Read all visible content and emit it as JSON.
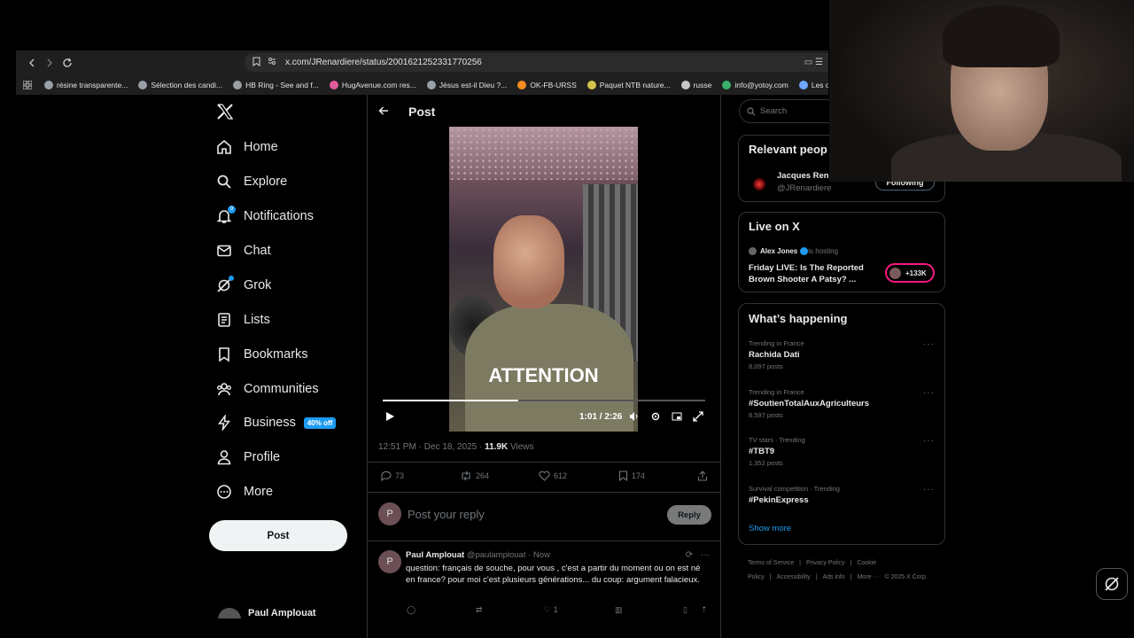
{
  "browser": {
    "url": "x.com/JRenardiere/status/2001621252331770256",
    "bookmarks": [
      {
        "label": "résine transparente...",
        "color": "#9aa0a6"
      },
      {
        "label": "Sélection des candi...",
        "color": "#9aa0a6"
      },
      {
        "label": "HB Ring - See and f...",
        "color": "#9aa0a6"
      },
      {
        "label": "HugAvenue.com res...",
        "color": "#e05b9a"
      },
      {
        "label": "Jésus est-il Dieu ?...",
        "color": "#9aa0a6"
      },
      {
        "label": "OK-FB-URSS",
        "color": "#f28b20"
      },
      {
        "label": "Paquet NTB nature...",
        "color": "#d4c24a"
      },
      {
        "label": "russe",
        "color": "#c7c7c7"
      },
      {
        "label": "info@yotoy.com",
        "color": "#3ab06b"
      },
      {
        "label": "Les concours",
        "color": "#6ea8ff"
      }
    ]
  },
  "nav": {
    "items": [
      {
        "label": "Home",
        "icon": "home-icon"
      },
      {
        "label": "Explore",
        "icon": "search-icon"
      },
      {
        "label": "Notifications",
        "icon": "bell-icon",
        "badge": "9"
      },
      {
        "label": "Chat",
        "icon": "mail-icon"
      },
      {
        "label": "Grok",
        "icon": "grok-icon"
      },
      {
        "label": "Lists",
        "icon": "list-icon"
      },
      {
        "label": "Bookmarks",
        "icon": "bookmark-icon"
      },
      {
        "label": "Communities",
        "icon": "people-icon"
      },
      {
        "label": "Business",
        "icon": "lightning-icon",
        "tag": "40% off"
      },
      {
        "label": "Profile",
        "icon": "person-icon"
      },
      {
        "label": "More",
        "icon": "more-circle-icon"
      }
    ],
    "post_button": "Post",
    "account_name": "Paul Amplouat"
  },
  "post": {
    "header_title": "Post",
    "video": {
      "caption": "ATTENTION",
      "time": "1:01 / 2:26",
      "progress": 0.42
    },
    "timestamp": "12:51 PM · Dec 18, 2025 · ",
    "views_count": "11.9K",
    "views_label": " Views",
    "actions": {
      "replies": "73",
      "reposts": "264",
      "likes": "612",
      "bookmarks": "174"
    },
    "reply_placeholder": "Post your reply",
    "reply_button": "Reply",
    "reply_avatar_letter": "P"
  },
  "reply": {
    "avatar_letter": "P",
    "name": "Paul Amplouat",
    "handle": " @paulamplouat · Now",
    "text": "question: français de souche, pour vous , c'est a partir du moment ou on est né en france? pour moi c'est plusieurs générations... du coup: argument falacieux.",
    "actions": {
      "likes": "1"
    }
  },
  "sidebar": {
    "search_placeholder": "Search",
    "relevant_title": "Relevant peop",
    "relevant_person": {
      "name": "Jacques Ren",
      "handle": "@JRenardiere",
      "button": "Following"
    },
    "live_title": "Live on X",
    "live": {
      "host": "Alex Jones",
      "hosting": " is hosting",
      "title": "Friday LIVE: Is The Reported Brown Shooter A Patsy? ...",
      "count": "+133K"
    },
    "happening_title": "What’s happening",
    "trends": [
      {
        "context": "Trending in France",
        "title": "Rachida Dati",
        "posts": "8,097 posts"
      },
      {
        "context": "Trending in France",
        "title": "#SoutienTotalAuxAgriculteurs",
        "posts": "8,597 posts"
      },
      {
        "context": "TV stars · Trending",
        "title": "#TBT9",
        "posts": "1,352 posts"
      },
      {
        "context": "Survival competition · Trending",
        "title": "#PekinExpress",
        "posts": ""
      }
    ],
    "show_more": "Show more",
    "footer": [
      "Terms of Service",
      "|",
      "Privacy Policy",
      "|",
      "Cookie Policy",
      "|",
      "Accessibility",
      "|",
      "Ads info",
      "|",
      "More ···",
      "© 2025 X Corp."
    ]
  },
  "colors": {
    "accent": "#1d9bf0",
    "live_pink": "#f91880",
    "background": "#000000"
  }
}
